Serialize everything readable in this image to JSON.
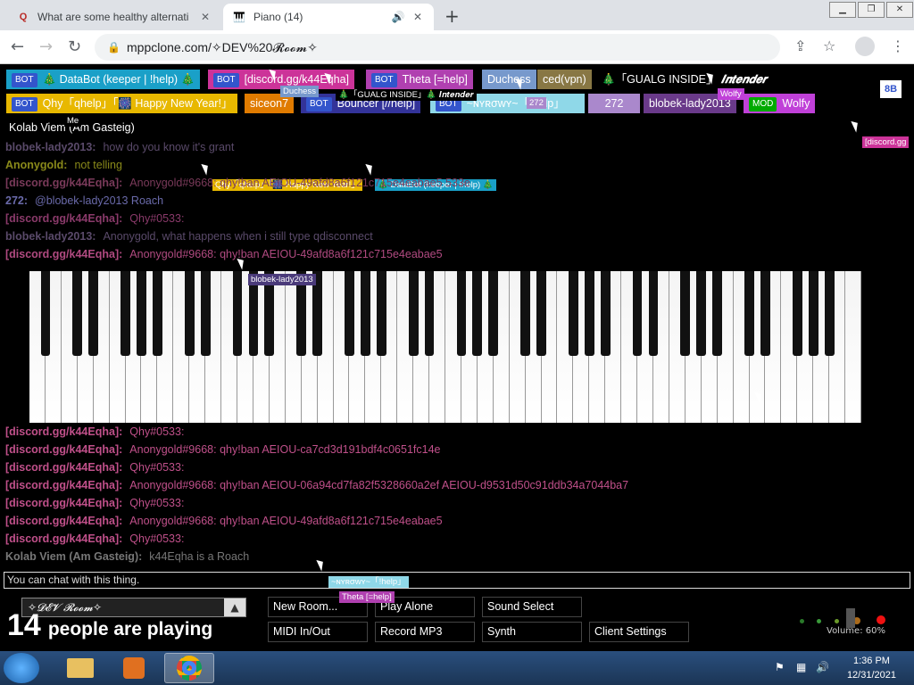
{
  "browser": {
    "tabs": [
      {
        "title": "What are some healthy alternati",
        "icon": "Q",
        "active": false
      },
      {
        "title": "Piano (14)",
        "icon": "piano",
        "active": true
      }
    ],
    "url": "mppclone.com/✧DEV%20𝓡𝓸𝓸𝓶✧"
  },
  "top_names": {
    "row1": [
      {
        "label": "🎄 DataBot (keeper | !help) 🎄",
        "tag": "BOT",
        "color": "#1aa0c8"
      },
      {
        "label": "[discord.gg/k44Eqha]",
        "tag": "BOT",
        "color": "#cc3399"
      },
      {
        "label": "Theta [=help]",
        "tag": "BOT",
        "color": "#b040b0"
      },
      {
        "label": "Duchess",
        "tag": "",
        "color": "#7799cc"
      },
      {
        "label": "ced(vpn)",
        "tag": "",
        "color": "#887744"
      },
      {
        "label": "🎄「GUALG INSIDE」🎄",
        "tag": "",
        "color": "#000000"
      },
      {
        "label": "𝑰𝒏𝒕𝒆𝒏𝒅𝒆𝒓",
        "tag": "",
        "color": "#000000"
      }
    ],
    "row2": [
      {
        "label": "Qhy「qhelp」「🎆 Happy New Year!」",
        "tag": "BOT",
        "color": "#e8b800"
      },
      {
        "label": "siceon7",
        "tag": "",
        "color": "#e07b00"
      },
      {
        "label": "Bouncer [//help]",
        "tag": "BOT",
        "color": "#333399"
      },
      {
        "label": "~ɴʏʀσwʏ~「!help」",
        "tag": "BOT",
        "color": "#8fd8e8"
      },
      {
        "label": "272",
        "tag": "",
        "color": "#aa88cc"
      },
      {
        "label": "blobek-lady2013",
        "tag": "",
        "color": "#6a3a8a"
      },
      {
        "label": "Wolfy",
        "tag": "MOD",
        "color": "#c040d8"
      }
    ],
    "row3": [
      {
        "label": "Kolab Viem (Am Gasteig)",
        "tag": "",
        "color": "#000000"
      }
    ],
    "toggle": "8B"
  },
  "cursors": {
    "duchess": "Duchess",
    "gualg": "🎄「GUALG INSIDE」🎄 𝑰𝒏𝒕𝒆𝒏𝒅𝒆𝒓",
    "wolfy": "Wolfy",
    "me": "Me",
    "discord": "[discord.gg",
    "qhy_bot": "Qhy「qhelp」「🎆 Happy New Year!」",
    "databot": "🎄 DataBot (keeper | !help) 🎄",
    "blobek": "blobek-lady2013",
    "n272": "272",
    "nyrowy": "~ɴʏʀσwʏ~「!help」",
    "theta": "Theta [=help]"
  },
  "chat": [
    {
      "user": "blobek-lady2013:",
      "msg": "how do you know it's grant",
      "color": "#6a5a7a",
      "faded": true
    },
    {
      "user": "Anonygold:",
      "msg": "not telling",
      "color": "#8a8a1a",
      "faded": false
    },
    {
      "user": "[discord.gg/k44Eqha]:",
      "msg": "Anonygold#9668: qhy!ban AEIOU-49afd8a6f121c715e4eabae5 533e",
      "color": "#7a3a5a",
      "faded": true
    },
    {
      "user": "272:",
      "msg": "@blobek-lady2013 Roach",
      "color": "#6a6aaa",
      "faded": true
    },
    {
      "user": "[discord.gg/k44Eqha]:",
      "msg": "Qhy#0533:",
      "color": "#8a3a6a",
      "faded": true
    },
    {
      "user": "blobek-lady2013:",
      "msg": "Anonygold, what happens when i still type qdisconnect",
      "color": "#6a5a7a",
      "faded": true
    },
    {
      "user": "[discord.gg/k44Eqha]:",
      "msg": "Anonygold#9668: qhy!ban AEIOU-49afd8a6f121c715e4eabae5",
      "color": "#b04a80",
      "faded": false
    }
  ],
  "chat_bottom": [
    {
      "user": "[discord.gg/k44Eqha]:",
      "msg": "Qhy#0533:",
      "color": "#c0508a"
    },
    {
      "user": "[discord.gg/k44Eqha]:",
      "msg": "Anonygold#9668: qhy!ban AEIOU-ca7cd3d191bdf4c0651fc14e",
      "color": "#c0508a"
    },
    {
      "user": "[discord.gg/k44Eqha]:",
      "msg": "Qhy#0533:",
      "color": "#c0508a"
    },
    {
      "user": "[discord.gg/k44Eqha]:",
      "msg": "Anonygold#9668: qhy!ban AEIOU-06a94cd7fa82f5328660a2ef AEIOU-d9531d50c91ddb34a7044ba7",
      "color": "#c0508a"
    },
    {
      "user": "[discord.gg/k44Eqha]:",
      "msg": "Qhy#0533:",
      "color": "#c0508a"
    },
    {
      "user": "[discord.gg/k44Eqha]:",
      "msg": "Anonygold#9668: qhy!ban AEIOU-49afd8a6f121c715e4eabae5",
      "color": "#c0508a"
    },
    {
      "user": "[discord.gg/k44Eqha]:",
      "msg": "Qhy#0533:",
      "color": "#c0508a"
    },
    {
      "user": "Kolab Viem (Am Gasteig):",
      "msg": "k44Eqha is a Roach",
      "color": "#777777"
    }
  ],
  "chat_input_placeholder": "You can chat with this thing.",
  "room_name": "✧𝓓𝓔𝓥 𝓡𝓸𝓸𝓶✧",
  "player_count": "14",
  "player_text": "people are playing",
  "buttons": {
    "new_room": "New Room...",
    "play_alone": "Play Alone",
    "sound_select": "Sound Select",
    "midi": "MIDI In/Out",
    "record": "Record MP3",
    "synth": "Synth",
    "client_settings": "Client Settings"
  },
  "volume": "Volume: 60%",
  "taskbar": {
    "time": "1:36 PM",
    "date": "12/31/2021"
  }
}
